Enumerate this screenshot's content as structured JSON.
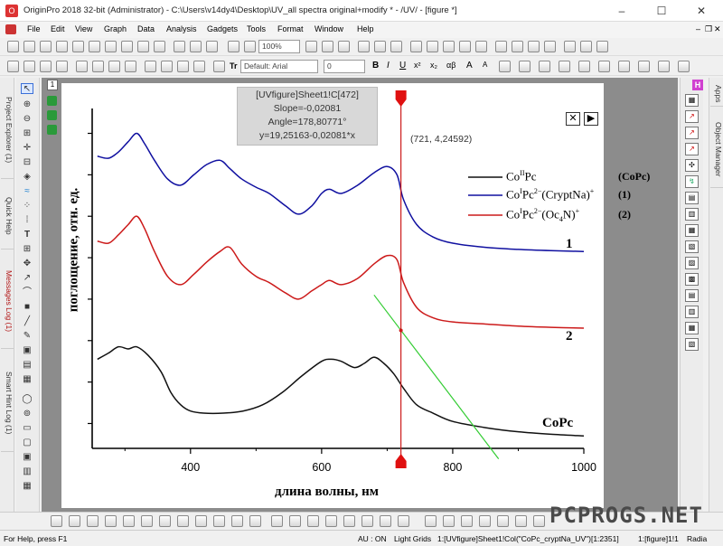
{
  "window": {
    "title": "OriginPro 2018 32-bit (Administrator) - C:\\Users\\v14dy4\\Desktop\\UV_all spectra original+modify * - /UV/ - [figure *]",
    "app_icon_letter": "O",
    "minimize": "–",
    "maximize": "☐",
    "close": "✕"
  },
  "menu": [
    "File",
    "Edit",
    "View",
    "Graph",
    "Data",
    "Analysis",
    "Gadgets",
    "Tools",
    "Format",
    "Window",
    "Help"
  ],
  "toolbar": {
    "zoom": "100%",
    "font_name": "Default: Arial",
    "font_size": "0",
    "tt_glyph": "Tr"
  },
  "dock_left": [
    "Project Explorer (1)",
    "Quick Help",
    "Messages Log (1)",
    "Smart Hint Log (1)"
  ],
  "dock_right": [
    "Apps",
    "Object Manager"
  ],
  "layer_badge": "1",
  "readout": {
    "line1": "[UVfigure]Sheet1!C[472]",
    "line2": "Slope=-0,02081",
    "line3": "Angle=178,80771°",
    "line4": "y=19,25163-0,02081*x"
  },
  "coord_label": "(721, 4,24592)",
  "controls": {
    "close": "✕",
    "next": "▶"
  },
  "chart_data": {
    "type": "line",
    "xlabel": "длина волны, нм",
    "ylabel": "поглощение, отн. ед.",
    "xlim": [
      250,
      1000
    ],
    "xticks": [
      "400",
      "600",
      "800",
      "1000"
    ],
    "series": [
      {
        "name": "1",
        "color": "#1010a0",
        "x": [
          258,
          275,
          290,
          305,
          318,
          330,
          345,
          365,
          385,
          405,
          425,
          445,
          460,
          478,
          500,
          520,
          545,
          565,
          585,
          600,
          612,
          630,
          655,
          680,
          700,
          715,
          725,
          745,
          770,
          800,
          850,
          900,
          950,
          1000
        ],
        "y": [
          8.45,
          8.4,
          8.55,
          8.8,
          9.0,
          8.75,
          8.35,
          7.9,
          7.75,
          8.0,
          8.25,
          8.35,
          8.15,
          7.9,
          7.7,
          7.55,
          7.25,
          7.05,
          7.25,
          7.55,
          7.65,
          7.55,
          7.75,
          8.05,
          8.2,
          8.0,
          7.4,
          6.8,
          6.5,
          6.35,
          6.25,
          6.2,
          6.17,
          6.15
        ]
      },
      {
        "name": "2",
        "color": "#cc1a1a",
        "x": [
          258,
          275,
          290,
          305,
          318,
          330,
          345,
          365,
          385,
          405,
          425,
          445,
          460,
          478,
          500,
          520,
          545,
          565,
          585,
          600,
          612,
          630,
          655,
          680,
          700,
          715,
          725,
          745,
          770,
          800,
          850,
          900,
          950,
          1000
        ],
        "y": [
          6.4,
          6.35,
          6.55,
          6.8,
          7.0,
          6.7,
          6.15,
          5.55,
          5.35,
          5.6,
          5.9,
          6.15,
          6.25,
          5.85,
          5.55,
          5.4,
          5.15,
          5.0,
          5.2,
          5.35,
          5.45,
          5.35,
          5.5,
          5.85,
          6.05,
          5.95,
          5.4,
          4.8,
          4.55,
          4.45,
          4.4,
          4.35,
          4.32,
          4.3
        ]
      },
      {
        "name": "CoPc",
        "color": "#111111",
        "x": [
          258,
          275,
          290,
          305,
          318,
          335,
          355,
          370,
          385,
          400,
          420,
          450,
          480,
          510,
          540,
          570,
          600,
          615,
          630,
          650,
          665,
          680,
          695,
          710,
          725,
          745,
          770,
          800,
          850,
          900,
          950,
          1000
        ],
        "y": [
          3.55,
          3.7,
          3.85,
          3.8,
          3.85,
          3.65,
          3.25,
          2.75,
          2.45,
          2.3,
          2.25,
          2.25,
          2.3,
          2.45,
          2.75,
          3.15,
          3.5,
          3.55,
          3.5,
          3.35,
          3.45,
          3.6,
          3.45,
          3.2,
          2.85,
          2.45,
          2.25,
          2.05,
          1.9,
          1.8,
          1.74,
          1.7
        ]
      }
    ],
    "tangent_line": {
      "color": "#33cc33",
      "slope": -0.02081,
      "intercept": 19.25163,
      "x": [
        680,
        870
      ]
    },
    "cursor_line": {
      "color": "#cc1a1a",
      "x": 721
    },
    "tangent_point": {
      "x": 721,
      "y": 4.24592
    },
    "legend": {
      "placement": "right",
      "entries": [
        {
          "color": "#111111",
          "label": "CoIIPc",
          "code": "(CoPc)"
        },
        {
          "color": "#1010a0",
          "label": "CoIPc2−(CryptNa)+",
          "code": "(1)"
        },
        {
          "color": "#cc1a1a",
          "label": "CoIPc2−(Oc4N)+",
          "code": "(2)"
        }
      ]
    },
    "curve_labels": [
      "1",
      "2",
      "CoPc"
    ]
  },
  "status": {
    "help": "For Help, press F1",
    "au": "AU : ON",
    "grid": "Light Grids",
    "col": "1:[UVfigure]Sheet1!Col(\"CoPc_cryptNa_UV\")[1:2351]",
    "sheet": "1:[figure]1!1",
    "units": "Radia"
  },
  "watermark": "PCPROGS.NET"
}
